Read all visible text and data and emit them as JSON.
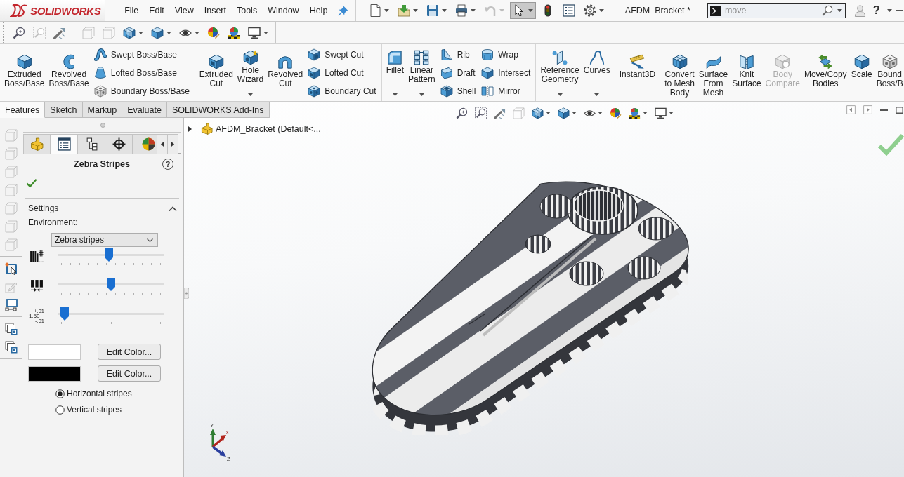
{
  "app": {
    "logo": "SOLIDWORKS"
  },
  "menu": [
    "File",
    "Edit",
    "View",
    "Insert",
    "Tools",
    "Window",
    "Help"
  ],
  "quick_access": [
    {
      "menu": true,
      "disabled": false,
      "pressed": false
    },
    {
      "menu": true,
      "disabled": false,
      "pressed": false
    },
    {
      "menu": true,
      "disabled": false,
      "pressed": false
    },
    {
      "menu": true,
      "disabled": false,
      "pressed": false
    },
    {
      "menu": true,
      "disabled": true,
      "pressed": false
    },
    {
      "menu": true,
      "disabled": false,
      "pressed": true
    },
    {
      "menu": false,
      "disabled": false,
      "pressed": false
    },
    {
      "menu": false,
      "disabled": false,
      "pressed": false
    },
    {
      "menu": true,
      "disabled": false,
      "pressed": false
    }
  ],
  "document_title": "AFDM_Bracket *",
  "command_search": {
    "value": "move"
  },
  "help": "?",
  "view_toolbar": [
    {
      "items": [
        {
          "menu": false,
          "disabled": false
        },
        {
          "menu": false,
          "disabled": true
        },
        {
          "menu": false,
          "disabled": false
        }
      ]
    },
    {
      "items": [
        {
          "menu": false,
          "disabled": true
        },
        {
          "menu": false,
          "disabled": true
        },
        {
          "menu": true,
          "disabled": false
        },
        {
          "menu": true,
          "disabled": false
        },
        {
          "menu": true,
          "disabled": false
        },
        {
          "menu": false,
          "disabled": false
        },
        {
          "menu": false,
          "disabled": false
        },
        {
          "menu": true,
          "disabled": false
        }
      ]
    }
  ],
  "ribbon": {
    "groups": [
      {
        "items": [
          {
            "kind": "large",
            "label": "Extruded\nBoss/Base",
            "menu": false,
            "disabled": false
          },
          {
            "kind": "large",
            "label": "Revolved\nBoss/Base",
            "menu": false,
            "disabled": false
          },
          {
            "kind": "stack",
            "items": [
              {
                "label": "Swept Boss/Base",
                "disabled": false
              },
              {
                "label": "Lofted Boss/Base",
                "disabled": false
              },
              {
                "label": "Boundary Boss/Base",
                "disabled": false
              }
            ]
          }
        ]
      },
      {
        "items": [
          {
            "kind": "large",
            "label": "Extruded\nCut",
            "menu": false,
            "disabled": false
          },
          {
            "kind": "large",
            "label": "Hole\nWizard",
            "menu": true,
            "disabled": false
          },
          {
            "kind": "large",
            "label": "Revolved\nCut",
            "menu": false,
            "disabled": false
          },
          {
            "kind": "stack",
            "items": [
              {
                "label": "Swept Cut",
                "disabled": false
              },
              {
                "label": "Lofted Cut",
                "disabled": false
              },
              {
                "label": "Boundary Cut",
                "disabled": false
              }
            ]
          }
        ]
      },
      {
        "items": [
          {
            "kind": "large",
            "label": "Fillet",
            "menu": true,
            "disabled": false
          },
          {
            "kind": "large",
            "label": "Linear\nPattern",
            "menu": true,
            "disabled": false
          },
          {
            "kind": "stack",
            "items": [
              {
                "label": "Rib",
                "disabled": false
              },
              {
                "label": "Draft",
                "disabled": false
              },
              {
                "label": "Shell",
                "disabled": false
              }
            ]
          },
          {
            "kind": "stack",
            "items": [
              {
                "label": "Wrap",
                "disabled": false
              },
              {
                "label": "Intersect",
                "disabled": false
              },
              {
                "label": "Mirror",
                "disabled": false
              }
            ]
          }
        ]
      },
      {
        "items": [
          {
            "kind": "large",
            "label": "Reference\nGeometry",
            "menu": true,
            "disabled": false
          },
          {
            "kind": "large",
            "label": "Curves",
            "menu": true,
            "disabled": false
          }
        ]
      },
      {
        "items": [
          {
            "kind": "large",
            "label": "Instant3D",
            "menu": false,
            "disabled": false
          }
        ]
      },
      {
        "items": [
          {
            "kind": "large",
            "label": "Convert\nto Mesh\nBody",
            "menu": false,
            "disabled": false
          },
          {
            "kind": "large",
            "label": "Surface\nFrom\nMesh",
            "menu": false,
            "disabled": false
          },
          {
            "kind": "large",
            "label": "Knit\nSurface",
            "menu": false,
            "disabled": false
          },
          {
            "kind": "large",
            "label": "Body\nCompare",
            "menu": false,
            "disabled": true
          },
          {
            "kind": "large",
            "label": "Move/Copy\nBodies",
            "menu": false,
            "disabled": false
          },
          {
            "kind": "large",
            "label": "Scale",
            "menu": false,
            "disabled": false
          },
          {
            "kind": "large",
            "label": "Bound\nBoss/B",
            "menu": false,
            "disabled": false
          }
        ]
      }
    ]
  },
  "tabs": [
    {
      "label": "Features",
      "selected": true
    },
    {
      "label": "Sketch",
      "selected": false
    },
    {
      "label": "Markup",
      "selected": false
    },
    {
      "label": "Evaluate",
      "selected": false
    },
    {
      "label": "SOLIDWORKS Add-Ins",
      "selected": false
    }
  ],
  "heads_up_toolbar": [
    {
      "menu": false,
      "disabled": false
    },
    {
      "menu": false,
      "disabled": false
    },
    {
      "menu": false,
      "disabled": false
    },
    {
      "menu": false,
      "disabled": true
    },
    {
      "menu": true,
      "disabled": false
    },
    {
      "menu": true,
      "disabled": false
    },
    {
      "menu": true,
      "disabled": false
    },
    {
      "menu": false,
      "disabled": false
    },
    {
      "menu": true,
      "disabled": false
    },
    {
      "menu": true,
      "disabled": false
    }
  ],
  "view_strip": [
    {
      "items": [
        {
          "disabled": true
        },
        {
          "disabled": true
        },
        {
          "disabled": true
        },
        {
          "disabled": true
        },
        {
          "disabled": true
        },
        {
          "disabled": true
        },
        {
          "disabled": true
        }
      ]
    },
    {
      "items": [
        {
          "disabled": false
        },
        {
          "disabled": true
        },
        {
          "disabled": false
        }
      ]
    },
    {
      "items": [
        {
          "disabled": false
        },
        {
          "disabled": false
        }
      ]
    }
  ],
  "property_manager": {
    "tabs": [
      {
        "selected": false
      },
      {
        "selected": true
      },
      {
        "selected": false
      },
      {
        "selected": false
      },
      {
        "selected": false
      }
    ],
    "title": "Zebra Stripes",
    "help": "?",
    "section": {
      "title": "Settings",
      "expanded": true
    },
    "environment_label": "Environment:",
    "environment": "Zebra stripes",
    "sliders": [
      {
        "kind": "stripe-count",
        "level": 0.48
      },
      {
        "kind": "stripe-width",
        "level": 0.5
      },
      {
        "kind": "precision",
        "level": 0.03,
        "label": [
          "+.01",
          "1.50",
          "-.01"
        ]
      }
    ],
    "colors": [
      {
        "color": "#ffffff",
        "button": "Edit Color..."
      },
      {
        "color": "#000000",
        "button": "Edit Color..."
      }
    ],
    "stripe_direction": [
      {
        "label": "Horizontal stripes",
        "selected": true
      },
      {
        "label": "Vertical stripes",
        "selected": false
      }
    ]
  },
  "feature_tree": {
    "label": "AFDM_Bracket (Default<...",
    "expanded": false
  },
  "triad": {
    "axes": [
      "Y",
      "X",
      "Z"
    ]
  }
}
